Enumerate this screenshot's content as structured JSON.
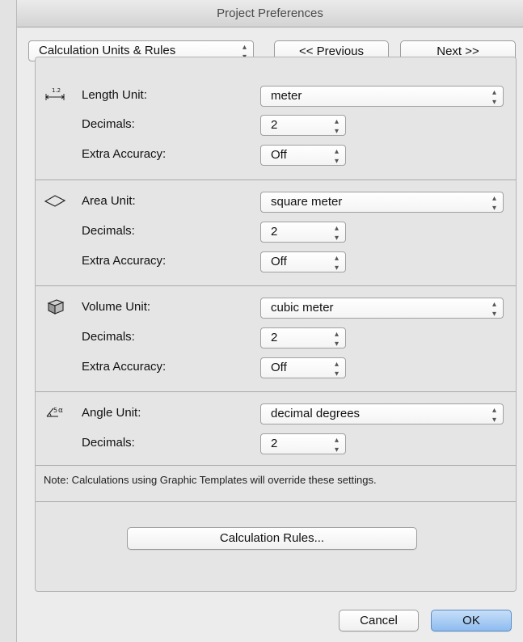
{
  "window": {
    "title": "Project Preferences"
  },
  "toolbar": {
    "section_select": "Calculation Units & Rules",
    "previous_label": "<< Previous",
    "next_label": "Next >>"
  },
  "length": {
    "label": "Length Unit:",
    "unit_value": "meter",
    "decimals_label": "Decimals:",
    "decimals_value": "2",
    "accuracy_label": "Extra Accuracy:",
    "accuracy_value": "Off"
  },
  "area": {
    "label": "Area Unit:",
    "unit_value": "square meter",
    "decimals_label": "Decimals:",
    "decimals_value": "2",
    "accuracy_label": "Extra Accuracy:",
    "accuracy_value": "Off"
  },
  "volume": {
    "label": "Volume Unit:",
    "unit_value": "cubic meter",
    "decimals_label": "Decimals:",
    "decimals_value": "2",
    "accuracy_label": "Extra Accuracy:",
    "accuracy_value": "Off"
  },
  "angle": {
    "label": "Angle Unit:",
    "unit_value": "decimal degrees",
    "decimals_label": "Decimals:",
    "decimals_value": "2"
  },
  "note": "Note: Calculations using Graphic Templates will override these settings.",
  "calculation_rules_label": "Calculation Rules...",
  "footer": {
    "cancel_label": "Cancel",
    "ok_label": "OK"
  },
  "icons": {
    "length": "length-measure-icon",
    "area": "area-parallelogram-icon",
    "volume": "volume-box-icon",
    "angle": "angle-icon",
    "popup_arrows": "up-down-arrows-icon"
  },
  "colors": {
    "ok_button": "#8ebcf0",
    "panel": "#e5e5e5"
  }
}
